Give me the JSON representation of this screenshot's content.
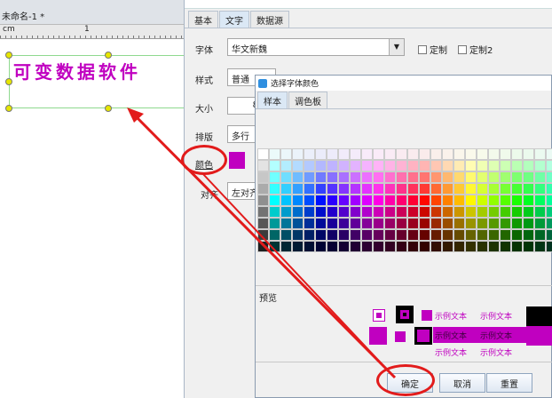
{
  "document": {
    "tab_title": "未命名-1 *",
    "ruler_labels": [
      "cm",
      "1"
    ],
    "text_content": "可变数据软件"
  },
  "properties": {
    "tabs": [
      "基本",
      "文字",
      "数据源"
    ],
    "font_label": "字体",
    "font_value": "华文新魏",
    "check1": "定制",
    "check2": "定制2",
    "style_label": "样式",
    "style_value": "普通",
    "size_label": "大小",
    "size_value": "8",
    "layout_label": "排版",
    "layout_value": "多行",
    "color_label": "颜色",
    "color_value": "#c000c0",
    "align_label": "对齐",
    "align_value": "左对齐"
  },
  "color_dialog": {
    "title": "选择字体颜色",
    "tabs": [
      "样本",
      "调色板"
    ],
    "preview_label": "预览",
    "sample_text": "示例文本",
    "buttons": {
      "ok": "确定",
      "cancel": "取消",
      "reset": "重置"
    },
    "selected_color": "#c000c0"
  }
}
